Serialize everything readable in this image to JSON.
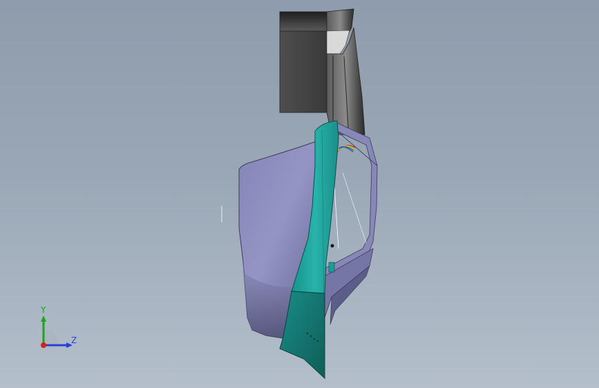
{
  "triad": {
    "y_label": "Y",
    "z_label": "Z",
    "colors": {
      "y": "#1aa51a",
      "z": "#2b3fd6",
      "x": "#d42020"
    }
  },
  "model": {
    "colors": {
      "background": "#9aa7b6",
      "lavender_body": "#8f8fc0",
      "teal_panel": "#1fa49d",
      "dark_teal": "#177d77",
      "charcoal_block": "#4a4a4a"
    }
  }
}
